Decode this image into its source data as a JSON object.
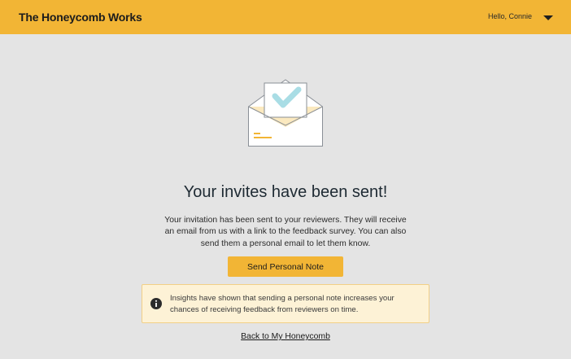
{
  "header": {
    "brand": "The Honeycomb Works",
    "greeting": "Hello, Connie",
    "menu_icon": "caret-down-icon"
  },
  "main": {
    "illustration_icon": "envelope-check-icon",
    "title": "Your invites have been sent!",
    "description": "Your invitation has been sent to your reviewers. They will receive an email from us with a link to the feedback survey. You can also send them a personal email to let them know.",
    "send_button_label": "Send Personal Note",
    "info": {
      "icon": "info-icon",
      "text": "Insights have shown that sending a personal note increases your chances of receiving feedback from reviewers on time."
    },
    "back_link": "Back to My Honeycomb"
  },
  "colors": {
    "accent": "#f2b535",
    "background": "#e4e4e4",
    "info_background": "#fdf2d6",
    "check": "#a9dde5"
  }
}
